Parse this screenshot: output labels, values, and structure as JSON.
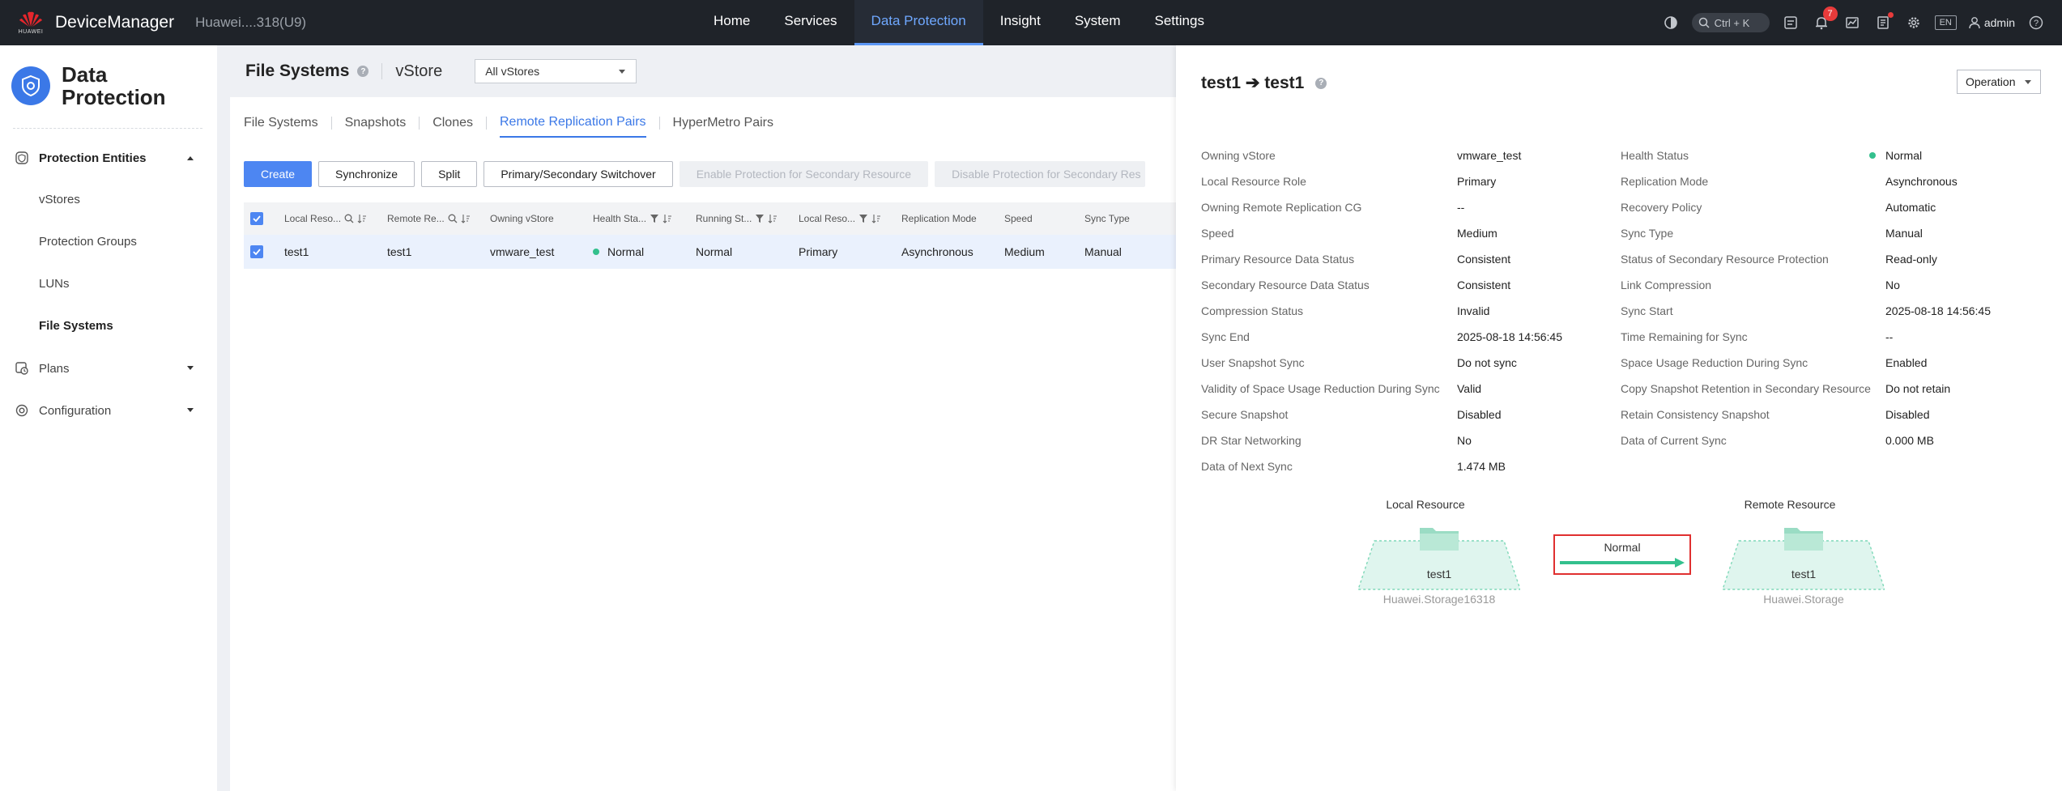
{
  "topbar": {
    "logo_text": "HUAWEI",
    "app_title": "DeviceManager",
    "device_name": "Huawei....318(U9)",
    "nav": [
      "Home",
      "Services",
      "Data Protection",
      "Insight",
      "System",
      "Settings"
    ],
    "active_nav": "Data Protection",
    "search_hint": "Ctrl + K",
    "alert_count": "7",
    "lang": "EN",
    "user": "admin"
  },
  "sidebar": {
    "title_line1": "Data",
    "title_line2": "Protection",
    "groups": [
      {
        "label": "Protection Entities",
        "icon": "shield-outline-icon",
        "expanded": true
      },
      {
        "label": "Plans",
        "icon": "plan-icon",
        "expanded": false
      },
      {
        "label": "Configuration",
        "icon": "gear-icon",
        "expanded": false
      }
    ],
    "items": [
      "vStores",
      "Protection Groups",
      "LUNs",
      "File Systems"
    ],
    "active_item": "File Systems"
  },
  "page": {
    "title": "File Systems",
    "vstore_label": "vStore",
    "vstore_select": "All vStores"
  },
  "tabs": [
    "File Systems",
    "Snapshots",
    "Clones",
    "Remote Replication Pairs",
    "HyperMetro Pairs"
  ],
  "active_tab": "Remote Replication Pairs",
  "toolbar": {
    "create": "Create",
    "synchronize": "Synchronize",
    "split": "Split",
    "switchover": "Primary/Secondary Switchover",
    "enable_protection": "Enable Protection for Secondary Resource",
    "disable_protection": "Disable Protection for Secondary Res"
  },
  "table": {
    "columns": [
      "Local Reso...",
      "Remote Re...",
      "Owning vStore",
      "Health Sta...",
      "Running St...",
      "Local Reso...",
      "Replication Mode",
      "Speed",
      "Sync Type"
    ],
    "rows": [
      [
        "test1",
        "test1",
        "vmware_test",
        "Normal",
        "Normal",
        "Primary",
        "Asynchronous",
        "Medium",
        "Manual"
      ]
    ]
  },
  "panel": {
    "title": "test1 ➔ test1",
    "operation": "Operation",
    "left_props": [
      {
        "k": "Owning vStore",
        "v": "vmware_test"
      },
      {
        "k": "Local Resource Role",
        "v": "Primary"
      },
      {
        "k": "Owning Remote Replication CG",
        "v": "--"
      },
      {
        "k": "Speed",
        "v": "Medium"
      },
      {
        "k": "Primary Resource Data Status",
        "v": "Consistent"
      },
      {
        "k": "Secondary Resource Data Status",
        "v": "Consistent"
      },
      {
        "k": "Compression Status",
        "v": "Invalid"
      },
      {
        "k": "Sync End",
        "v": "2025-08-18 14:56:45"
      },
      {
        "k": "User Snapshot Sync",
        "v": "Do not sync"
      },
      {
        "k": "Validity of Space Usage Reduction During Sync",
        "v": "Valid"
      },
      {
        "k": "Secure Snapshot",
        "v": "Disabled"
      },
      {
        "k": "DR Star Networking",
        "v": "No"
      },
      {
        "k": "Data of Next Sync",
        "v": "1.474 MB"
      }
    ],
    "right_props": [
      {
        "k": "Health Status",
        "v": "Normal"
      },
      {
        "k": "Replication Mode",
        "v": "Asynchronous"
      },
      {
        "k": "Recovery Policy",
        "v": "Automatic"
      },
      {
        "k": "Sync Type",
        "v": "Manual"
      },
      {
        "k": "Status of Secondary Resource Protection",
        "v": "Read-only"
      },
      {
        "k": "Link Compression",
        "v": "No"
      },
      {
        "k": "Sync Start",
        "v": "2025-08-18 14:56:45"
      },
      {
        "k": "Time Remaining for Sync",
        "v": "--"
      },
      {
        "k": "Space Usage Reduction During Sync",
        "v": "Enabled"
      },
      {
        "k": "Copy Snapshot Retention in Secondary Resource",
        "v": "Do not retain"
      },
      {
        "k": "Retain Consistency Snapshot",
        "v": "Disabled"
      },
      {
        "k": "Data of Current Sync",
        "v": "0.000 MB"
      }
    ],
    "diagram": {
      "local_label": "Local Resource",
      "remote_label": "Remote Resource",
      "link_status": "Normal",
      "local_fs": "test1",
      "local_storage": "Huawei.Storage16318",
      "remote_fs": "test1",
      "remote_storage": "Huawei.Storage"
    }
  },
  "colors": {
    "accent": "#3b78e7",
    "status_ok": "#33c08d",
    "topbar": "#1f2329",
    "highlight_border": "#e03030"
  }
}
